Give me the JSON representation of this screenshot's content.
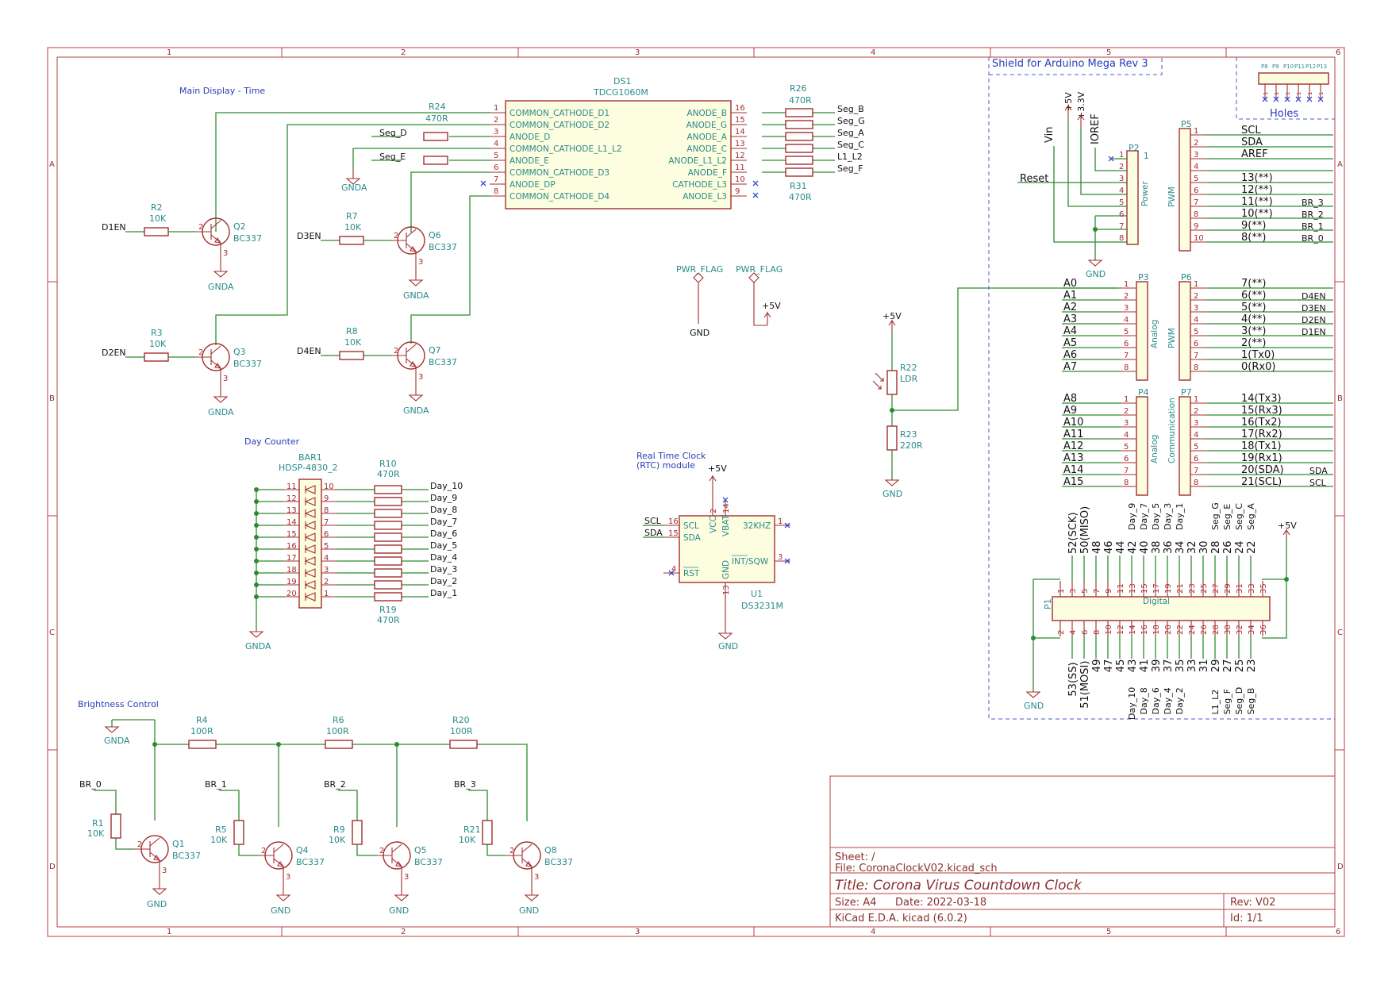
{
  "title_block": {
    "sheet": "Sheet: /",
    "file": "File: CoronaClockV02.kicad_sch",
    "title": "Title: Corona Virus Countdown Clock",
    "size": "Size: A4",
    "date": "Date: 2022-03-18",
    "rev": "Rev: V02",
    "tool": "KiCad E.D.A.  kicad (6.0.2)",
    "id": "Id: 1/1"
  },
  "frame": {
    "columns": [
      "1",
      "2",
      "3",
      "4",
      "5",
      "6"
    ],
    "rows": [
      "A",
      "B",
      "C",
      "D"
    ]
  },
  "notes": {
    "main_display": "Main Display - Time",
    "day_counter": "Day Counter",
    "brightness": "Brightness Control",
    "rtc_1": "Real Time Clock",
    "rtc_2": "(RTC) module",
    "shield": "Shield for Arduino Mega Rev 3",
    "holes": "Holes"
  },
  "display": {
    "ref": "DS1",
    "value": "TDCG1060M",
    "left_pins": [
      {
        "num": "1",
        "name": "COMMON_CATHODE_D1"
      },
      {
        "num": "2",
        "name": "COMMON_CATHODE_D2"
      },
      {
        "num": "3",
        "name": "ANODE_D"
      },
      {
        "num": "4",
        "name": "COMMON_CATHODE_L1_L2"
      },
      {
        "num": "5",
        "name": "ANODE_E"
      },
      {
        "num": "6",
        "name": "COMMON_CATHODE_D3"
      },
      {
        "num": "7",
        "name": "ANODE_DP"
      },
      {
        "num": "8",
        "name": "COMMON_CATHODE_D4"
      }
    ],
    "right_pins": [
      {
        "num": "16",
        "name": "ANODE_B",
        "net": "Seg_B"
      },
      {
        "num": "15",
        "name": "ANODE_G",
        "net": "Seg_G"
      },
      {
        "num": "14",
        "name": "ANODE_A",
        "net": "Seg_A"
      },
      {
        "num": "13",
        "name": "ANODE_C",
        "net": "Seg_C"
      },
      {
        "num": "12",
        "name": "ANODE_L1_L2",
        "net": "L1_L2"
      },
      {
        "num": "11",
        "name": "ANODE_F",
        "net": "Seg_F"
      },
      {
        "num": "10",
        "name": "CATHODE_L3",
        "net": ""
      },
      {
        "num": "9",
        "name": "ANODE_L3",
        "net": ""
      }
    ]
  },
  "resistors": {
    "r24": {
      "ref": "R24",
      "value": "470R"
    },
    "r26": {
      "ref": "R26",
      "value": "470R"
    },
    "r31": {
      "ref": "R31",
      "value": "470R"
    },
    "r2": {
      "ref": "R2",
      "value": "10K"
    },
    "r3": {
      "ref": "R3",
      "value": "10K"
    },
    "r7": {
      "ref": "R7",
      "value": "10K"
    },
    "r8": {
      "ref": "R8",
      "value": "10K"
    },
    "r10": {
      "ref": "R10",
      "value": "470R"
    },
    "r19": {
      "ref": "R19",
      "value": "470R"
    },
    "r22": {
      "ref": "R22",
      "value": "LDR"
    },
    "r23": {
      "ref": "R23",
      "value": "220R"
    },
    "r4": {
      "ref": "R4",
      "value": "100R"
    },
    "r6": {
      "ref": "R6",
      "value": "100R"
    },
    "r20": {
      "ref": "R20",
      "value": "100R"
    },
    "r1": {
      "ref": "R1",
      "value": "10K"
    },
    "r5": {
      "ref": "R5",
      "value": "10K"
    },
    "r9": {
      "ref": "R9",
      "value": "10K"
    },
    "r21": {
      "ref": "R21",
      "value": "10K"
    }
  },
  "transistors": {
    "q2": {
      "ref": "Q2",
      "value": "BC337",
      "input": "D1EN",
      "gnd": "GNDA"
    },
    "q3": {
      "ref": "Q3",
      "value": "BC337",
      "input": "D2EN",
      "gnd": "GNDA"
    },
    "q6": {
      "ref": "Q6",
      "value": "BC337",
      "input": "D3EN",
      "gnd": "GNDA"
    },
    "q7": {
      "ref": "Q7",
      "value": "BC337",
      "input": "D4EN",
      "gnd": "GNDA"
    },
    "q1": {
      "ref": "Q1",
      "value": "BC337",
      "input": "BR_0",
      "gnd": "GND"
    },
    "q4": {
      "ref": "Q4",
      "value": "BC337",
      "input": "BR_1",
      "gnd": "GND"
    },
    "q5": {
      "ref": "Q5",
      "value": "BC337",
      "input": "BR_2",
      "gnd": "GND"
    },
    "q8": {
      "ref": "Q8",
      "value": "BC337",
      "input": "BR_3",
      "gnd": "GND"
    }
  },
  "nets": {
    "seg_d": "Seg_D",
    "seg_e": "Seg_E",
    "gnda": "GNDA",
    "gnd": "GND",
    "vcc5": "+5V",
    "pwr_flag": "PWR_FLAG"
  },
  "bargraph": {
    "ref": "BAR1",
    "value": "HDSP-4830_2",
    "left_pins": [
      "11",
      "12",
      "13",
      "14",
      "15",
      "16",
      "17",
      "18",
      "19",
      "20"
    ],
    "right_pins": [
      "10",
      "9",
      "8",
      "7",
      "6",
      "5",
      "4",
      "3",
      "2",
      "1"
    ],
    "nets": [
      "Day_10",
      "Day_9",
      "Day_8",
      "Day_7",
      "Day_6",
      "Day_5",
      "Day_4",
      "Day_3",
      "Day_2",
      "Day_1"
    ]
  },
  "rtc": {
    "ref": "U1",
    "value": "DS3231M",
    "pins": {
      "scl": {
        "num": "16",
        "name": "SCL",
        "net": "SCL"
      },
      "sda": {
        "num": "15",
        "name": "SDA",
        "net": "SDA"
      },
      "rst": {
        "num": "4",
        "name": "RST"
      },
      "vcc": {
        "num": "2",
        "name": "VCC"
      },
      "vbat": {
        "num": "14",
        "name": "VBAT"
      },
      "gnd": {
        "num": "13",
        "name": "GND"
      },
      "k32": {
        "num": "1",
        "name": "32KHZ"
      },
      "int": {
        "num": "3",
        "name": "INT/SQW"
      }
    }
  },
  "p2": {
    "ref": "P2",
    "label": "Power",
    "mark": "1",
    "top_labels": [
      "Vin",
      "+5V",
      "+3.3V",
      "IOREF"
    ],
    "reset": "Reset",
    "pins": [
      "1",
      "2",
      "3",
      "4",
      "5",
      "6",
      "7",
      "8"
    ]
  },
  "p5": {
    "ref": "P5",
    "label": "PWM",
    "pins": [
      {
        "num": "1",
        "name": "SCL",
        "net": ""
      },
      {
        "num": "2",
        "name": "SDA",
        "net": ""
      },
      {
        "num": "3",
        "name": "AREF",
        "net": ""
      },
      {
        "num": "4",
        "name": "",
        "net": ""
      },
      {
        "num": "5",
        "name": "13(**)",
        "net": ""
      },
      {
        "num": "6",
        "name": "12(**)",
        "net": ""
      },
      {
        "num": "7",
        "name": "11(**)",
        "net": "BR_3"
      },
      {
        "num": "8",
        "name": "10(**)",
        "net": "BR_2"
      },
      {
        "num": "9",
        "name": "9(**)",
        "net": "BR_1"
      },
      {
        "num": "10",
        "name": "8(**)",
        "net": "BR_0"
      }
    ]
  },
  "p3": {
    "ref": "P3",
    "label": "Analog",
    "pins": [
      {
        "num": "1",
        "name": "A0"
      },
      {
        "num": "2",
        "name": "A1"
      },
      {
        "num": "3",
        "name": "A2"
      },
      {
        "num": "4",
        "name": "A3"
      },
      {
        "num": "5",
        "name": "A4"
      },
      {
        "num": "6",
        "name": "A5"
      },
      {
        "num": "7",
        "name": "A6"
      },
      {
        "num": "8",
        "name": "A7"
      }
    ]
  },
  "p6": {
    "ref": "P6",
    "label": "PWM",
    "pins": [
      {
        "num": "1",
        "name": "7(**)",
        "net": ""
      },
      {
        "num": "2",
        "name": "6(**)",
        "net": "D4EN"
      },
      {
        "num": "3",
        "name": "5(**)",
        "net": "D3EN"
      },
      {
        "num": "4",
        "name": "4(**)",
        "net": "D2EN"
      },
      {
        "num": "5",
        "name": "3(**)",
        "net": "D1EN"
      },
      {
        "num": "6",
        "name": "2(**)",
        "net": ""
      },
      {
        "num": "7",
        "name": "1(Tx0)",
        "net": ""
      },
      {
        "num": "8",
        "name": "0(Rx0)",
        "net": ""
      }
    ]
  },
  "p4": {
    "ref": "P4",
    "label": "Analog",
    "pins": [
      {
        "num": "1",
        "name": "A8"
      },
      {
        "num": "2",
        "name": "A9"
      },
      {
        "num": "3",
        "name": "A10"
      },
      {
        "num": "4",
        "name": "A11"
      },
      {
        "num": "5",
        "name": "A12"
      },
      {
        "num": "6",
        "name": "A13"
      },
      {
        "num": "7",
        "name": "A14"
      },
      {
        "num": "8",
        "name": "A15"
      }
    ]
  },
  "p7": {
    "ref": "P7",
    "label": "Communication",
    "pins": [
      {
        "num": "1",
        "name": "14(Tx3)",
        "net": ""
      },
      {
        "num": "2",
        "name": "15(Rx3)",
        "net": ""
      },
      {
        "num": "3",
        "name": "16(Tx2)",
        "net": ""
      },
      {
        "num": "4",
        "name": "17(Rx2)",
        "net": ""
      },
      {
        "num": "5",
        "name": "18(Tx1)",
        "net": ""
      },
      {
        "num": "6",
        "name": "19(Rx1)",
        "net": ""
      },
      {
        "num": "7",
        "name": "20(SDA)",
        "net": "SDA"
      },
      {
        "num": "8",
        "name": "21(SCL)",
        "net": "SCL"
      }
    ]
  },
  "p1": {
    "ref": "P1",
    "label": "Digital",
    "top_pins": [
      "1",
      "3",
      "5",
      "7",
      "9",
      "11",
      "13",
      "15",
      "17",
      "19",
      "21",
      "23",
      "25",
      "27",
      "29",
      "31",
      "33",
      "35"
    ],
    "bottom_pins": [
      "2",
      "4",
      "6",
      "8",
      "10",
      "12",
      "14",
      "16",
      "18",
      "20",
      "22",
      "24",
      "26",
      "28",
      "30",
      "32",
      "34",
      "36"
    ],
    "top_names": [
      "",
      "52(SCK)",
      "50(MISO)",
      "48",
      "46",
      "44",
      "42",
      "40",
      "38",
      "36",
      "34",
      "32",
      "30",
      "28",
      "26",
      "24",
      "22",
      ""
    ],
    "top_nets": [
      "",
      "",
      "",
      "",
      "",
      "",
      "Day_9",
      "Day_7",
      "Day_5",
      "Day_3",
      "Day_1",
      "",
      "",
      "Seg_G",
      "Seg_E",
      "Seg_C",
      "Seg_A",
      ""
    ],
    "bottom_names": [
      "",
      "53(SS)",
      "51(MOSI)",
      "49",
      "47",
      "45",
      "43",
      "41",
      "39",
      "37",
      "35",
      "33",
      "31",
      "29",
      "27",
      "25",
      "23",
      ""
    ],
    "bottom_nets": [
      "",
      "",
      "",
      "",
      "",
      "",
      "Day_10",
      "Day_8",
      "Day_6",
      "Day_4",
      "Day_2",
      "",
      "",
      "L1_L2",
      "Seg_F",
      "Seg_D",
      "Seg_B",
      ""
    ]
  },
  "holes": {
    "labels": [
      "P8",
      "P9",
      "P10",
      "P11",
      "P12",
      "P13"
    ]
  }
}
